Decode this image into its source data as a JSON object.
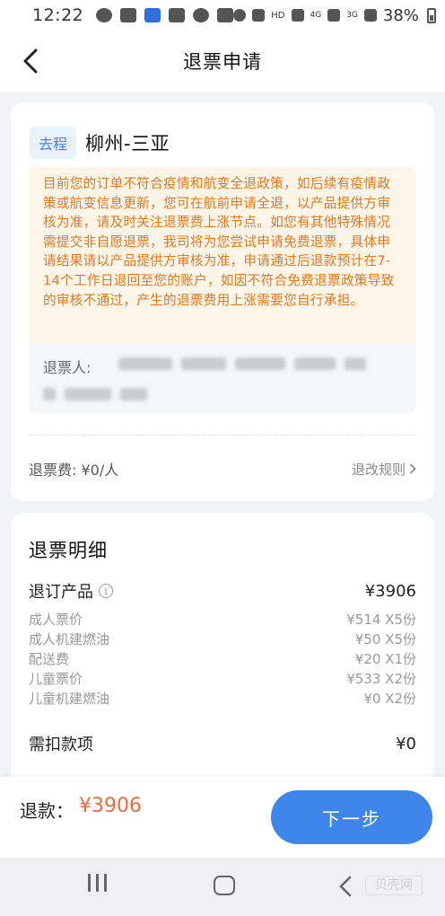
{
  "status_bar": {
    "time": "12:22",
    "network": "HD",
    "signal_1": "4G",
    "signal_2": "3G",
    "battery": "38%"
  },
  "header": {
    "title": "退票申请",
    "back_icon": "chevron-left-icon"
  },
  "trip": {
    "badge": "去程",
    "route": "柳州-三亚"
  },
  "notice": {
    "text": "目前您的订单不符合疫情和航变全退政策，如后续有疫情政策或航变信息更新，您可在航前申请全退，以产品提供方审核为准，请及时关注退票费上涨节点。如您有其他特殊情况需提交非自愿退票，我司将为您尝试申请免费退票，具体申请结果请以产品提供方审核为准，申请通过后退款预计在7-14个工作日退回至您的账户，如因不符合免费退票政策导致的审核不通过，产生的退票费用上涨需要您自行承担。",
    "color": "#e07722"
  },
  "passenger": {
    "label": "退票人:"
  },
  "fee": {
    "text": "退票费: ¥0/人",
    "rules_link": "退改规则"
  },
  "detail": {
    "title": "退票明细",
    "product_label": "退订产品",
    "product_total": "¥3906",
    "items": [
      {
        "name": "成人票价",
        "value": "¥514  X5份"
      },
      {
        "name": "成人机建燃油",
        "value": "¥50  X5份"
      },
      {
        "name": "配送费",
        "value": "¥20  X1份"
      },
      {
        "name": "儿童票价",
        "value": "¥533  X2份"
      },
      {
        "name": "儿童机建燃油",
        "value": "¥0  X2份"
      }
    ],
    "deduct_label": "需扣款项",
    "deduct_value": "¥0"
  },
  "bottom": {
    "refund_label": "退款：",
    "refund_amount": "¥3906",
    "next_button": "下一步",
    "accent": "#3f86ea",
    "amount_color": "#ec6a3c"
  },
  "watermark": "贝壳网"
}
